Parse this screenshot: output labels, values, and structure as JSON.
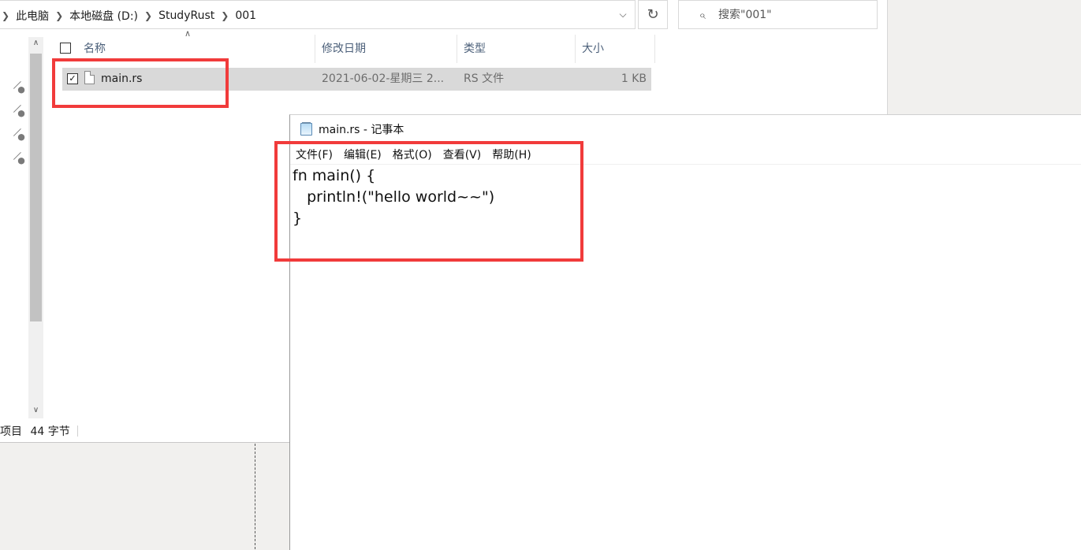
{
  "explorer": {
    "breadcrumb": [
      "此电脑",
      "本地磁盘 (D:)",
      "StudyRust",
      "001"
    ],
    "search_placeholder": "搜索\"001\"",
    "columns": {
      "name": "名称",
      "date": "修改日期",
      "type": "类型",
      "size": "大小"
    },
    "files": [
      {
        "name": "main.rs",
        "date": "2021-06-02-星期三 2...",
        "type": "RS 文件",
        "size": "1 KB",
        "selected": true
      }
    ],
    "status": {
      "items_suffix": "项目",
      "selection": "44 字节"
    }
  },
  "notepad": {
    "title": "main.rs - 记事本",
    "menu": [
      "文件(F)",
      "编辑(E)",
      "格式(O)",
      "查看(V)",
      "帮助(H)"
    ],
    "content": "fn main() {\n   println!(\"hello world~~\")\n}"
  },
  "colors": {
    "highlight_box": "#f13b3b",
    "selection_row": "#d9d9d9"
  }
}
